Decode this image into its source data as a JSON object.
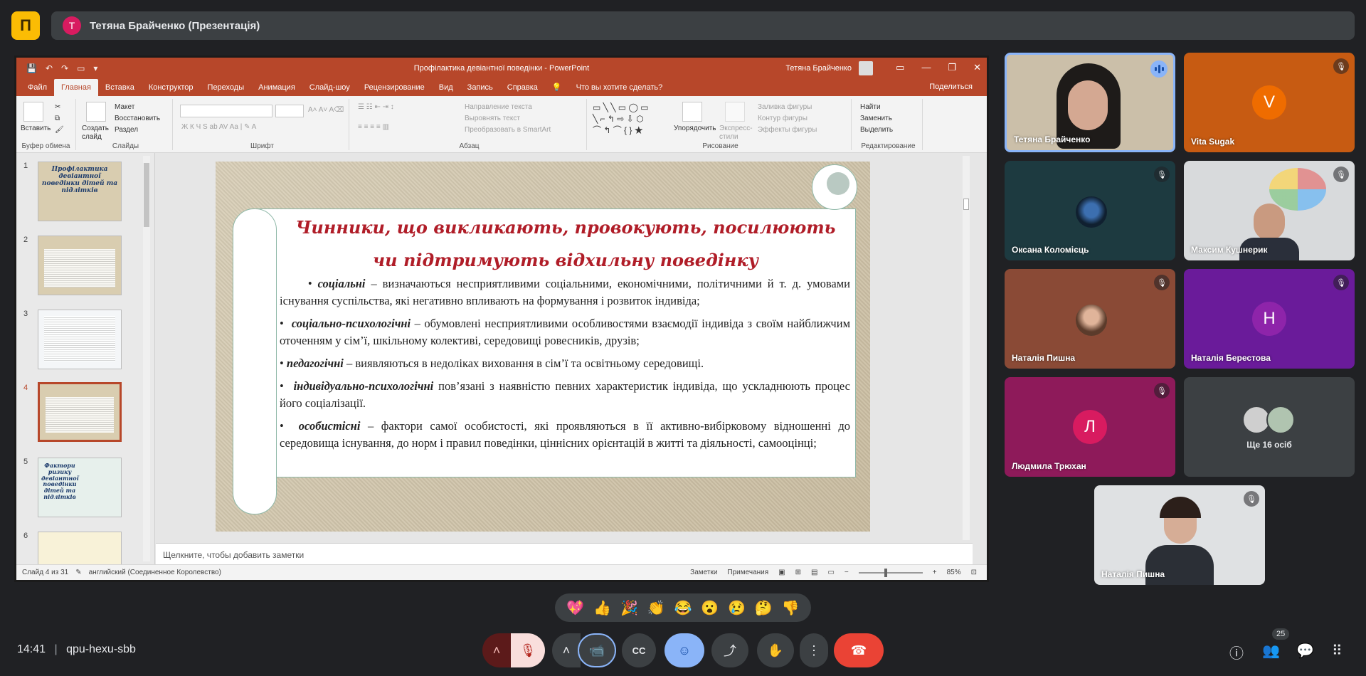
{
  "meet": {
    "presenter_initial": "Т",
    "presenter_label": "Тетяна Брайченко (Презентація)",
    "time": "14:41",
    "meeting_code": "qpu-hexu-sbb",
    "people_count": "25",
    "colors": {
      "bg": "#202124",
      "tile_blue": "#8ab4f8",
      "end_call": "#ea4335"
    }
  },
  "ppt": {
    "quick_access": [
      "💾",
      "↶",
      "↷",
      "▭",
      "▾"
    ],
    "document_title": "Профілактика девіантної поведінки  -  PowerPoint",
    "user_name": "Тетяна Брайченко",
    "tabs": [
      "Файл",
      "Главная",
      "Вставка",
      "Конструктор",
      "Переходы",
      "Анимация",
      "Слайд-шоу",
      "Рецензирование",
      "Вид",
      "Запись",
      "Справка",
      "💡",
      "Что вы хотите сделать?"
    ],
    "share": "Поделиться",
    "ribbon": {
      "paste": "Вставить",
      "clipboard_group": "Буфер обмена",
      "new_slide": "Создать слайд",
      "layout": "Макет",
      "reset": "Восстановить",
      "section": "Раздел",
      "slides_group": "Слайды",
      "font_group": "Шрифт",
      "text_direction": "Направление текста",
      "align_text": "Выровнять текст",
      "smartart": "Преобразовать в SmartArt",
      "paragraph_group": "Абзац",
      "arrange": "Упорядочить",
      "quick_styles": "Экспресс-стили",
      "fill": "Заливка фигуры",
      "outline": "Контур фигуры",
      "effects": "Эффекты фигуры",
      "drawing_group": "Рисование",
      "find": "Найти",
      "replace": "Заменить",
      "select": "Выделить",
      "editing_group": "Редактирование"
    },
    "thumbnails": [
      {
        "num": "1",
        "title": "Профілактика девіантної поведінки дітей та підлітків"
      },
      {
        "num": "2",
        "title": ""
      },
      {
        "num": "3",
        "title": ""
      },
      {
        "num": "4",
        "title": ""
      },
      {
        "num": "5",
        "title": "Фактори ризику девіантної поведінки дітей та підлітків"
      },
      {
        "num": "6",
        "title": ""
      }
    ],
    "slide": {
      "title_line1": "Чинники, що викликають, провокують, посилюють",
      "title_line2": "чи підтримують відхильну поведінку",
      "bullets": [
        {
          "term": "соціальні",
          "text": " – визначаються несприятливими соціальними, економічними, політичними й т. д. умовами існування суспільства, які негативно впливають на формування і розвиток індивіда;"
        },
        {
          "term": "соціально-психологічні",
          "text": " – обумовлені несприятливими особливостями взаємодії індивіда з своїм найближчим оточенням у сім’ї, шкільному колективі, середовищі ровесників, друзів;"
        },
        {
          "term": "педагогічні",
          "text": " – виявляються в недоліках виховання в сім’ї та освітньому середовищі."
        },
        {
          "term": "індивідуально-психологічні",
          "text": " пов’язані з наявністю певних характеристик індивіда, що ускладнюють процес його соціалізації."
        },
        {
          "term": "особистісні",
          "text": " – фактори самої особистості, які проявляються в її активно-вибірковому відношенні до середовища існування, до норм і правил поведінки, ціннісних орієнтацій в житті та діяльності, самооцінці;"
        }
      ]
    },
    "notes_placeholder": "Щелкните, чтобы добавить заметки",
    "status": {
      "slide_of": "Слайд 4 из 31",
      "language": "английский (Соединенное Королевство)",
      "notes": "Заметки",
      "comments": "Примечания",
      "zoom": "85%"
    }
  },
  "participants": [
    {
      "name": "Тетяна Брайченко",
      "type": "video",
      "speaking": true
    },
    {
      "name": "Vita Sugak",
      "type": "avatar",
      "initial": "V",
      "color": "#ef6c00",
      "bg": "#c75b12"
    },
    {
      "name": "Оксана Коломієць",
      "type": "photo",
      "bg": "#1d3a40"
    },
    {
      "name": "Максим Кушнерик",
      "type": "video"
    },
    {
      "name": "Наталія Пишна",
      "type": "photo",
      "bg": "#8a4a36"
    },
    {
      "name": "Наталія Берестова",
      "type": "avatar",
      "initial": "Н",
      "color": "#8e24aa",
      "bg": "#6a1b9a"
    },
    {
      "name": "Людмила Трюхан",
      "type": "avatar",
      "initial": "Л",
      "color": "#d81b60",
      "bg": "#8e1a5a"
    },
    {
      "name": "Ще 16 осіб",
      "type": "more"
    },
    {
      "name": "Наталія Пишна",
      "type": "video"
    }
  ],
  "reactions": [
    "💖",
    "👍",
    "🎉",
    "👏",
    "😂",
    "😮",
    "😢",
    "🤔",
    "👎"
  ],
  "controls": {
    "mic_off": "🎙",
    "camera": "📹",
    "captions": "CC",
    "emoji": "☺",
    "present": "⤴",
    "hand": "✋",
    "more": "⋮",
    "end": "☎",
    "info": "ⓘ",
    "people": "👥",
    "chat": "💬",
    "activities": "⠿"
  }
}
